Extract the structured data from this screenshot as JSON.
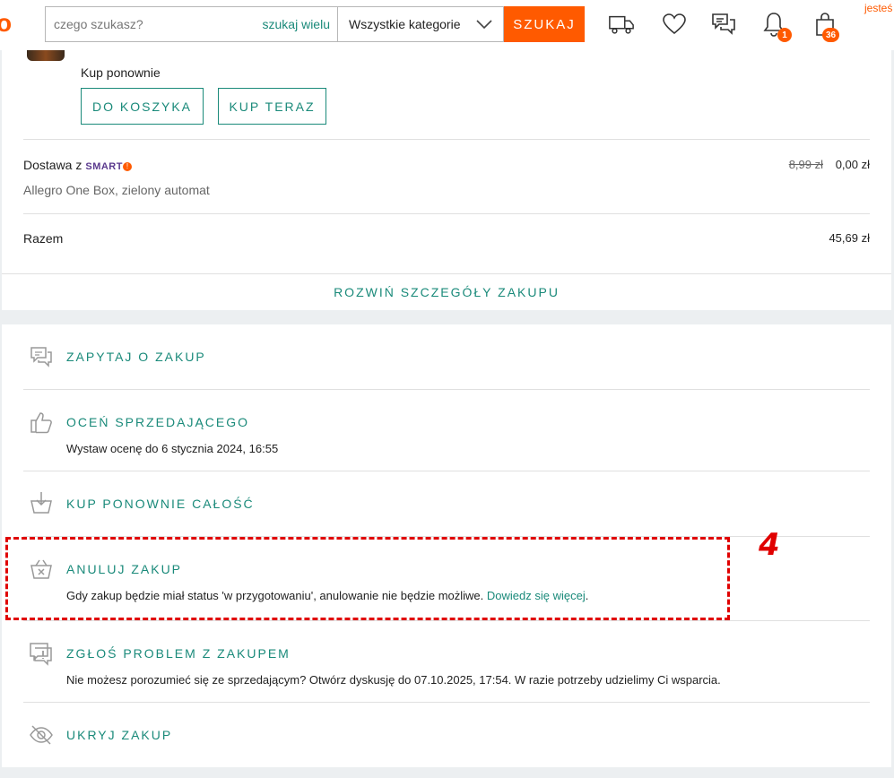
{
  "header": {
    "logo_fragment": "o",
    "search_placeholder": "czego szukasz?",
    "search_many_label": "szukaj wielu",
    "category_value": "Wszystkie kategorie",
    "search_button": "SZUKAJ",
    "notifications_count": "1",
    "cart_count": "36",
    "account_fragment": "jesteś",
    "accent_color": "#ff5a00"
  },
  "order": {
    "buy_again_label": "Kup ponownie",
    "to_cart_button": "DO KOSZYKA",
    "buy_now_button": "KUP TERAZ",
    "delivery_label": "Dostawa z",
    "smart_logo": "SMART",
    "smart_bang": "!",
    "delivery_method": "Allegro One Box, zielony automat",
    "delivery_price_old": "8,99 zł",
    "delivery_price_new": "0,00 zł",
    "total_label": "Razem",
    "total_value": "45,69 zł",
    "expand_details": "ROZWIŃ SZCZEGÓŁY ZAKUPU"
  },
  "actions": [
    {
      "title": "ZAPYTAJ O ZAKUP",
      "icon": "chat-bubbles-icon"
    },
    {
      "title": "OCEŃ SPRZEDAJĄCEGO",
      "desc": "Wystaw ocenę do 6 stycznia 2024, 16:55",
      "icon": "thumbs-up-icon"
    },
    {
      "title": "KUP PONOWNIE CAŁOŚĆ",
      "icon": "basket-download-icon"
    },
    {
      "title": "ANULUJ ZAKUP",
      "desc": "Gdy zakup będzie miał status 'w przygotowaniu', anulowanie nie będzie możliwe.",
      "link": "Dowiedz się więcej",
      "icon": "basket-cancel-icon"
    },
    {
      "title": "ZGŁOŚ PROBLEM Z ZAKUPEM",
      "desc": "Nie możesz porozumieć się ze sprzedającym? Otwórz dyskusję do 07.10.2025, 17:54. W razie potrzeby udzielimy Ci wsparcia.",
      "icon": "report-problem-icon"
    },
    {
      "title": "UKRYJ ZAKUP",
      "icon": "eye-hidden-icon"
    }
  ],
  "annotation": {
    "number": "4",
    "color": "#e00000"
  },
  "colors": {
    "teal": "#1a8a7a",
    "orange": "#ff5a00",
    "background": "#eceff1"
  }
}
